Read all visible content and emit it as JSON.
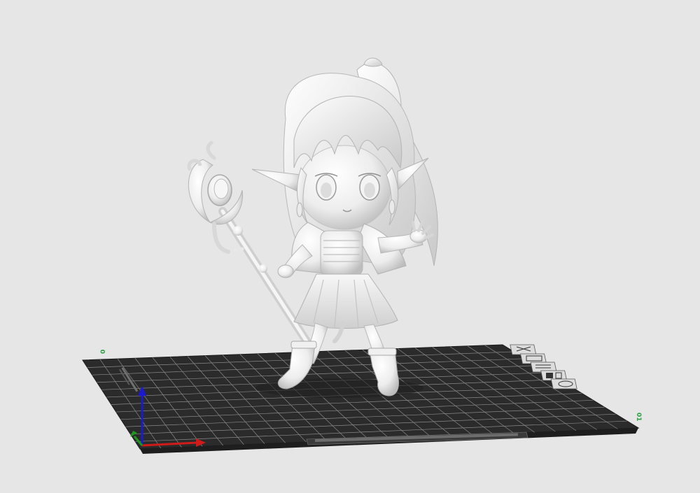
{
  "viewport": {
    "background": "#e6e6e6"
  },
  "build_plate": {
    "color": "#2b2b2b",
    "grid_color": "#8a8a8a",
    "grid_columns": 24,
    "grid_rows": 12,
    "corner_label_left": "0",
    "corner_label_right": "01"
  },
  "axes": {
    "x_color": "#d11a1a",
    "y_color": "#1a9a1a",
    "z_color": "#1a1ad1"
  },
  "model": {
    "color": "#f2f2f2",
    "shade": "#c8c8c8"
  },
  "side_icons": [
    {
      "name": "plate-icon-1"
    },
    {
      "name": "plate-icon-2"
    },
    {
      "name": "plate-icon-3"
    },
    {
      "name": "plate-icon-4"
    },
    {
      "name": "plate-icon-5"
    }
  ]
}
